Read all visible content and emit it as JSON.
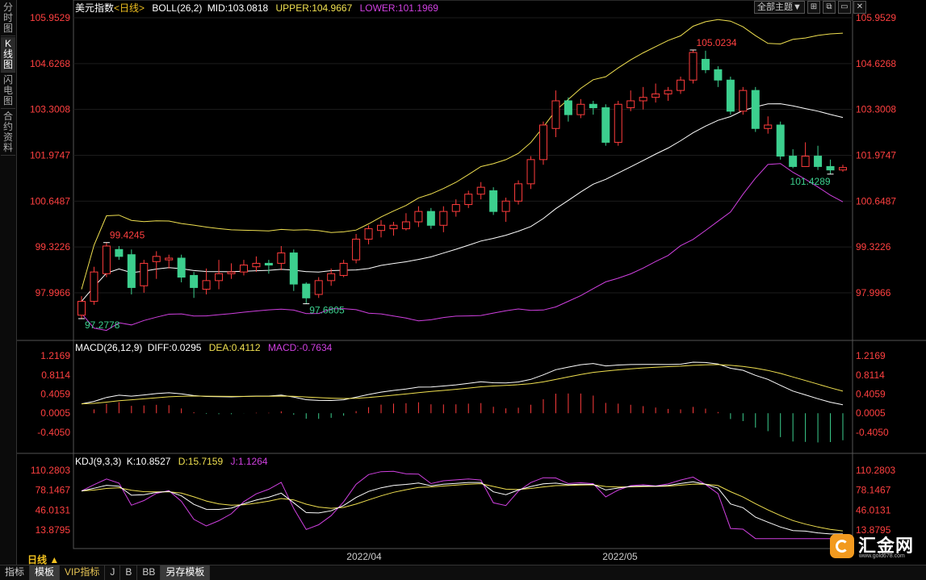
{
  "sidebar": {
    "tabs": [
      {
        "label": "分时图",
        "active": false
      },
      {
        "label": "K线图",
        "active": true
      },
      {
        "label": "闪电图",
        "active": false
      },
      {
        "label": "合约资料",
        "active": false
      }
    ]
  },
  "header": {
    "name": "美元指数",
    "period_tag": "<日线>",
    "boll": "BOLL(26,2)",
    "mid": "MID:103.0818",
    "upper": "UPPER:104.9667",
    "lower": "LOWER:101.1969",
    "theme_button": "全部主题▼",
    "icons": [
      "expand-icon",
      "restore-icon",
      "window-icon",
      "close-icon"
    ]
  },
  "macd_header": {
    "name": "MACD(26,12,9)",
    "diff": "DIFF:0.0295",
    "dea": "DEA:0.4112",
    "macd": "MACD:-0.7634"
  },
  "kdj_header": {
    "name": "KDJ(9,3,3)",
    "k": "K:10.8527",
    "d": "D:15.7159",
    "j": "J:1.1264"
  },
  "axes": {
    "price_ticks": [
      "105.9529",
      "104.6268",
      "103.3008",
      "101.9747",
      "100.6487",
      "99.3226",
      "97.9966"
    ],
    "macd_ticks": [
      "1.2169",
      "0.8114",
      "0.4059",
      "0.0005",
      "-0.4050"
    ],
    "kdj_ticks": [
      "110.2803",
      "78.1467",
      "46.0131",
      "13.8795"
    ],
    "date_labels": [
      "2022/04",
      "2022/05"
    ]
  },
  "annotations": {
    "high1": "99.4245",
    "low1": "97.2778",
    "low2": "97.6805",
    "high2": "105.0234",
    "low3": "101.4289"
  },
  "bottom": {
    "period": "日线 ▲",
    "buttons": [
      "指标",
      "模板",
      "VIP指标",
      "J",
      "B",
      "BB",
      "另存模板"
    ]
  },
  "logo": {
    "name": "汇金网",
    "url_text": "www.gold678.com"
  },
  "colors": {
    "up": "#ff3c3c",
    "down": "#3ccf8e",
    "mid": "#ffffff",
    "upper": "#f0e050",
    "lower": "#d040e0",
    "diff": "#ffffff",
    "dea": "#f0e050",
    "j": "#d040e0"
  },
  "chart_data": {
    "type": "candlestick",
    "candles": [
      [
        97.35,
        97.75,
        97.25,
        97.9
      ],
      [
        97.75,
        98.6,
        97.65,
        98.75
      ],
      [
        98.55,
        99.35,
        98.45,
        99.45
      ],
      [
        99.25,
        99.05,
        98.95,
        99.35
      ],
      [
        99.1,
        98.15,
        97.95,
        99.25
      ],
      [
        98.2,
        98.85,
        98.0,
        98.95
      ],
      [
        98.9,
        99.05,
        98.4,
        99.2
      ],
      [
        98.95,
        99.0,
        98.7,
        99.1
      ],
      [
        99.0,
        98.45,
        98.3,
        99.1
      ],
      [
        98.5,
        98.15,
        97.85,
        98.6
      ],
      [
        98.1,
        98.35,
        97.95,
        98.7
      ],
      [
        98.35,
        98.55,
        98.1,
        98.95
      ],
      [
        98.55,
        98.6,
        98.4,
        98.85
      ],
      [
        98.6,
        98.8,
        98.5,
        98.95
      ],
      [
        98.75,
        98.85,
        98.6,
        99.05
      ],
      [
        98.85,
        98.8,
        98.55,
        98.95
      ],
      [
        98.85,
        99.15,
        98.65,
        99.35
      ],
      [
        99.15,
        98.25,
        98.05,
        99.25
      ],
      [
        98.25,
        97.85,
        97.68,
        98.3
      ],
      [
        97.95,
        98.35,
        97.85,
        98.45
      ],
      [
        98.35,
        98.55,
        98.2,
        98.7
      ],
      [
        98.5,
        98.85,
        98.45,
        98.95
      ],
      [
        98.95,
        99.55,
        98.85,
        99.7
      ],
      [
        99.55,
        99.85,
        99.4,
        99.95
      ],
      [
        99.8,
        99.95,
        99.6,
        100.1
      ],
      [
        99.85,
        99.95,
        99.65,
        100.05
      ],
      [
        99.85,
        100.05,
        99.8,
        100.3
      ],
      [
        100.05,
        100.35,
        99.9,
        100.5
      ],
      [
        100.35,
        99.95,
        99.85,
        100.45
      ],
      [
        99.95,
        100.35,
        99.75,
        100.5
      ],
      [
        100.35,
        100.55,
        100.2,
        100.7
      ],
      [
        100.55,
        100.85,
        100.45,
        100.95
      ],
      [
        100.85,
        101.05,
        100.7,
        101.2
      ],
      [
        100.95,
        100.35,
        100.25,
        101.05
      ],
      [
        100.35,
        100.65,
        100.05,
        100.75
      ],
      [
        100.65,
        101.15,
        100.55,
        101.25
      ],
      [
        101.15,
        101.85,
        101.0,
        101.95
      ],
      [
        101.85,
        102.85,
        101.7,
        102.95
      ],
      [
        102.75,
        103.55,
        102.5,
        103.85
      ],
      [
        103.55,
        103.15,
        102.95,
        103.65
      ],
      [
        103.15,
        103.45,
        103.05,
        103.6
      ],
      [
        103.45,
        103.35,
        103.15,
        103.55
      ],
      [
        103.35,
        102.35,
        102.25,
        103.45
      ],
      [
        102.35,
        103.45,
        102.25,
        103.55
      ],
      [
        103.35,
        103.55,
        103.25,
        103.85
      ],
      [
        103.55,
        103.65,
        103.3,
        103.95
      ],
      [
        103.65,
        103.75,
        103.5,
        104.05
      ],
      [
        103.75,
        103.85,
        103.55,
        103.95
      ],
      [
        103.85,
        104.15,
        103.75,
        104.25
      ],
      [
        104.15,
        104.95,
        104.05,
        105.02
      ],
      [
        104.75,
        104.45,
        104.35,
        105.0
      ],
      [
        104.45,
        104.15,
        103.95,
        104.55
      ],
      [
        104.15,
        103.25,
        103.15,
        104.25
      ],
      [
        103.25,
        103.85,
        103.15,
        103.95
      ],
      [
        103.85,
        102.75,
        102.65,
        103.95
      ],
      [
        102.75,
        102.85,
        102.6,
        103.1
      ],
      [
        102.85,
        101.95,
        101.85,
        102.95
      ],
      [
        101.95,
        101.65,
        101.6,
        102.15
      ],
      [
        101.65,
        101.95,
        101.65,
        102.35
      ],
      [
        101.95,
        101.65,
        101.55,
        102.25
      ],
      [
        101.65,
        101.55,
        101.43,
        101.85
      ],
      [
        101.55,
        101.62,
        101.5,
        101.7
      ]
    ]
  }
}
